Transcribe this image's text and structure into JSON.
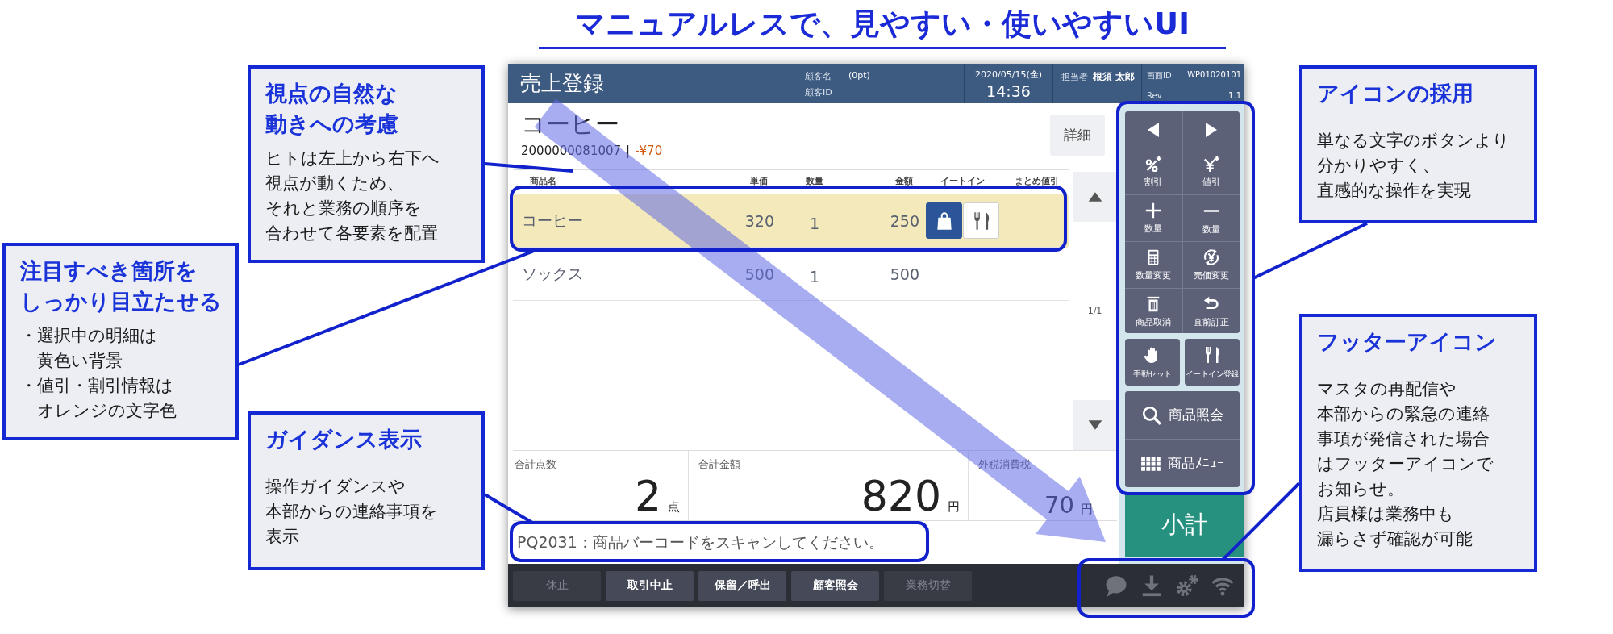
{
  "title": "マニュアルレスで、見やすい・使いやすいUI",
  "pos_screen": {
    "header": {
      "title": "売上登録",
      "customer_name_label": "顧客名",
      "customer_points": "(0pt)",
      "customer_id_label": "顧客ID",
      "date": "2020/05/15(金)",
      "time": "14:36",
      "staff_label": "担当者",
      "staff_name": "根須 太郎",
      "screen_id_label": "画面ID",
      "screen_id": "WP01020101",
      "rev_label": "Rev",
      "rev": "1.1"
    },
    "item": {
      "name": "コーヒー",
      "code": "2000000081007",
      "separator": "|",
      "discount": "-¥70",
      "detail_button": "詳細"
    },
    "table": {
      "columns": [
        "商品名",
        "単価",
        "数量",
        "金額",
        "イートイン",
        "まとめ値引"
      ],
      "rows": [
        {
          "cells": [
            "コーヒー",
            "320",
            "1",
            "250"
          ],
          "selected": true,
          "eat_in_options": [
            {
              "kind": "takeout",
              "selected": true
            },
            {
              "kind": "dine_in",
              "selected": false
            }
          ]
        },
        {
          "cells": [
            "ソックス",
            "500",
            "1",
            "500"
          ],
          "selected": false
        }
      ]
    },
    "pager": "1/1",
    "totals": [
      {
        "label": "合計点数",
        "value": "2",
        "unit": "点"
      },
      {
        "label": "合計金額",
        "value": "820",
        "unit": "円"
      },
      {
        "label": "外税消費税",
        "value": "70",
        "unit": "円"
      }
    ],
    "guidance": "PQ2031：商品バーコードをスキャンしてください。",
    "function_keys": [
      {
        "kind": "prev"
      },
      {
        "kind": "next"
      },
      {
        "kind": "percent_discount",
        "label": "割引"
      },
      {
        "kind": "yen_discount",
        "label": "値引"
      },
      {
        "kind": "plus",
        "label": "数量"
      },
      {
        "kind": "minus",
        "label": "数量"
      },
      {
        "kind": "calculator",
        "label": "数量変更"
      },
      {
        "kind": "price_change",
        "label": "売価変更"
      },
      {
        "kind": "trash",
        "label": "商品取消"
      },
      {
        "kind": "undo",
        "label": "直前訂正"
      }
    ],
    "quick_keys": [
      {
        "kind": "hand",
        "label": "手動セット"
      },
      {
        "kind": "fork_knife",
        "label": "イートイン登録"
      }
    ],
    "lookup_keys": [
      {
        "kind": "search",
        "label": "商品照会"
      },
      {
        "kind": "grid",
        "label": "商品ﾒﾆｭｰ"
      }
    ],
    "subtotal_button": "小計",
    "footer_buttons": [
      {
        "label": "休止",
        "disabled": true
      },
      {
        "label": "取引中止",
        "disabled": false
      },
      {
        "label": "保留／呼出",
        "disabled": false
      },
      {
        "label": "顧客照会",
        "disabled": false
      },
      {
        "label": "業務切替",
        "disabled": true
      }
    ],
    "status_icons": [
      {
        "kind": "chat"
      },
      {
        "kind": "download"
      },
      {
        "kind": "settings"
      },
      {
        "kind": "wifi"
      }
    ]
  },
  "callouts": [
    {
      "title_lines": [
        "視点の自然な",
        "動きへの考慮"
      ],
      "body_lines": [
        "ヒトは左上から右下へ",
        "視点が動くため、",
        "それと業務の順序を",
        "合わせて各要素を配置"
      ]
    },
    {
      "title_lines": [
        "注目すべき箇所を",
        "しっかり目立たせる"
      ],
      "bullets": [
        {
          "marker": "・",
          "lines": [
            "選択中の明細は",
            "黄色い背景"
          ]
        },
        {
          "marker": "・",
          "lines": [
            "値引・割引情報は",
            "オレンジの文字色"
          ]
        }
      ]
    },
    {
      "title_lines": [
        "ガイダンス表示"
      ],
      "body_lines": [
        "操作ガイダンスや",
        "本部からの連絡事項を",
        "表示"
      ]
    },
    {
      "title_lines": [
        "アイコンの採用"
      ],
      "body_lines": [
        "単なる文字のボタンより",
        "分かりやすく、",
        "直感的な操作を実現"
      ]
    },
    {
      "title_lines": [
        "フッターアイコン"
      ],
      "body_lines": [
        "マスタの再配信や",
        "本部からの緊急の連絡",
        "事項が発信された場合",
        "はフッターアイコンで",
        "お知らせ。",
        "店員様は業務中も",
        "漏らさず確認が可能"
      ]
    }
  ]
}
